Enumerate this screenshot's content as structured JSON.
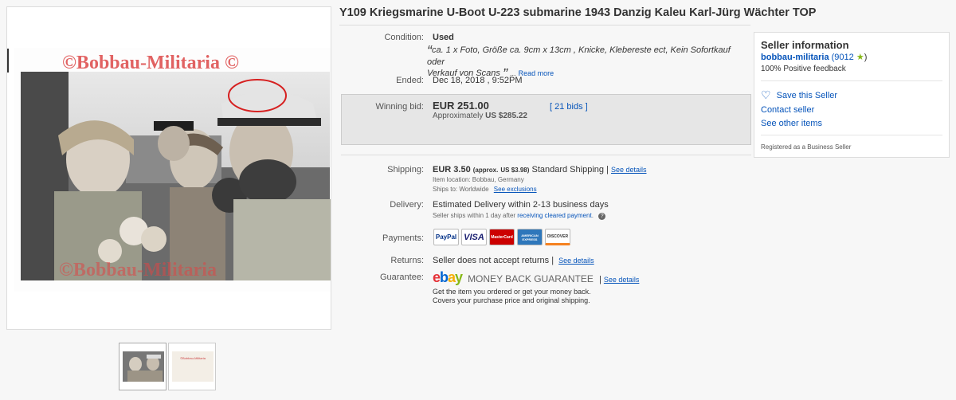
{
  "title": "Y109 Kriegsmarine U-Boot U-223 submarine 1943 Danzig Kaleu Karl-Jürg Wächter TOP",
  "gallery": {
    "watermark": "©Bobbau-Militaria ©",
    "watermark_bottom": "©Bobbau-Militaria",
    "thumb2_watermark": "©Bobbau-Militaria"
  },
  "condition": {
    "label": "Condition:",
    "value": "Used",
    "open_quote": "“",
    "desc_line1": "ca. 1 x Foto, Größe ca. 9cm x 13cm , Knicke, Klebereste ect, Kein Sofortkauf oder",
    "desc_line2": "Verkauf von Scans",
    "close_quote": "”",
    "ellipsis": "...",
    "read_more": "Read more"
  },
  "ended": {
    "label": "Ended:",
    "value": "Dec 18, 2018 , 9:52PM"
  },
  "bid": {
    "label": "Winning bid:",
    "amount": "EUR 251.00",
    "approx_prefix": "Approximately",
    "approx_value": "US $285.22",
    "bids": "[ 21 bids ]"
  },
  "shipping": {
    "label": "Shipping:",
    "amount": "EUR 3.50",
    "approx": "(approx.",
    "approx_value": "US $3.98)",
    "method": "Standard Shipping |",
    "see_details": "See details",
    "item_location": "Item location:  Bobbau, Germany",
    "ships_to": "Ships to:  Worldwide",
    "see_exclusions": "See exclusions"
  },
  "delivery": {
    "label": "Delivery:",
    "value": "Estimated Delivery within 2-13 business days",
    "note_prefix": "Seller ships within 1 day after",
    "note_link": "receiving cleared payment",
    "note_suffix": "."
  },
  "payments": {
    "label": "Payments:",
    "cards": [
      "PayPal",
      "VISA",
      "MasterCard",
      "AMERICAN EXPRESS",
      "DISCOVER"
    ]
  },
  "returns": {
    "label": "Returns:",
    "value": "Seller does not accept returns |",
    "see_details": "See details"
  },
  "guarantee": {
    "label": "Guarantee:",
    "logo_e": "e",
    "logo_b": "b",
    "logo_a": "a",
    "logo_y": "y",
    "mbg": "MONEY BACK GUARANTEE",
    "sep": "|",
    "see_details": "See details",
    "line1": "Get the item you ordered or get your money back.",
    "line2": "Covers your purchase price and original shipping."
  },
  "seller": {
    "heading": "Seller information",
    "name": "bobbau-militaria",
    "score": "(9012",
    "score_close": ")",
    "feedback": "100% Positive feedback",
    "save": "Save this Seller",
    "contact": "Contact seller",
    "other": "See other items",
    "registered": "Registered as a Business Seller"
  },
  "colors": {
    "link": "#0654ba",
    "ebay_e": "#e53238",
    "ebay_b": "#0064d2",
    "ebay_a": "#f5af02",
    "ebay_y": "#86b817",
    "star": "#86b817"
  }
}
